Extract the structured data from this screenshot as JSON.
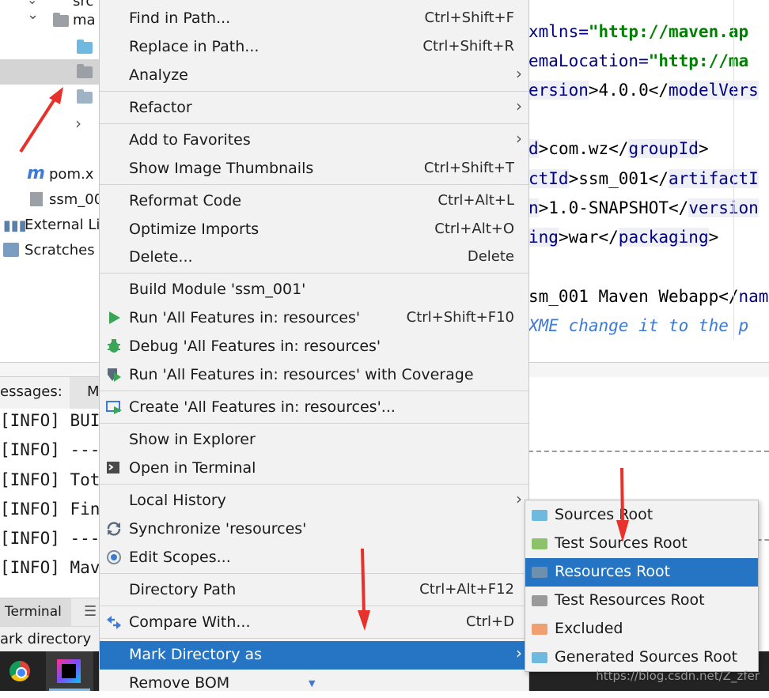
{
  "project_tree": {
    "items": [
      {
        "label": "src"
      },
      {
        "label": "ma"
      },
      {
        "label": "pom.x"
      },
      {
        "label": "ssm_00"
      },
      {
        "label": "External Li"
      },
      {
        "label": "Scratches"
      }
    ]
  },
  "editor": {
    "lines": [
      {
        "a": "xmlns=",
        "b": "\"http://maven.ap"
      },
      {
        "a": "emaLocation=",
        "b": "\"http://ma"
      },
      {
        "a": "ersion",
        "b": ">4.0.0</",
        "c": "modelVers"
      },
      {
        "a": "d",
        "b": ">com.wz</",
        "c": "groupId",
        "d": ">"
      },
      {
        "a": "ctId",
        "b": ">ssm_001</",
        "c": "artifactI"
      },
      {
        "a": "n",
        "b": ">1.0-SNAPSHOT</",
        "c": "version"
      },
      {
        "a": "ing",
        "b": ">war</",
        "c": "packaging",
        "d": ">"
      },
      {
        "a": "sm_001 Maven Webapp</",
        "b": "nam"
      },
      {
        "a": "XME change it to the p"
      }
    ]
  },
  "build_panel": {
    "tab_label": "essages:",
    "tab2_label": "M",
    "lines": [
      "[INFO] BUI",
      "[INFO] ---",
      "[INFO] Tot",
      "[INFO] Fin",
      "[INFO] ---",
      "[INFO] Mav"
    ],
    "terminal_label": "Terminal",
    "status_text": "ark directory"
  },
  "context_menu": {
    "items": [
      {
        "label": "Find in Path...",
        "shortcut": "Ctrl+Shift+F"
      },
      {
        "label": "Replace in Path...",
        "shortcut": "Ctrl+Shift+R"
      },
      {
        "label": "Analyze",
        "submenu": true
      },
      {
        "label": "Refactor",
        "submenu": true
      },
      {
        "label": "Add to Favorites",
        "submenu": true
      },
      {
        "label": "Show Image Thumbnails",
        "shortcut": "Ctrl+Shift+T"
      },
      {
        "label": "Reformat Code",
        "shortcut": "Ctrl+Alt+L"
      },
      {
        "label": "Optimize Imports",
        "shortcut": "Ctrl+Alt+O"
      },
      {
        "label": "Delete...",
        "shortcut": "Delete"
      },
      {
        "label": "Build Module 'ssm_001'"
      },
      {
        "label": "Run 'All Features in: resources'",
        "shortcut": "Ctrl+Shift+F10",
        "icon": "run-icon"
      },
      {
        "label": "Debug 'All Features in: resources'",
        "icon": "debug-icon"
      },
      {
        "label": "Run 'All Features in: resources' with Coverage",
        "icon": "coverage-icon"
      },
      {
        "label": "Create 'All Features in: resources'...",
        "icon": "create-config-icon"
      },
      {
        "label": "Show in Explorer"
      },
      {
        "label": "Open in Terminal",
        "icon": "terminal-icon"
      },
      {
        "label": "Local History",
        "submenu": true
      },
      {
        "label": "Synchronize 'resources'",
        "icon": "sync-icon"
      },
      {
        "label": "Edit Scopes...",
        "icon": "scope-icon"
      },
      {
        "label": "Directory Path",
        "shortcut": "Ctrl+Alt+F12"
      },
      {
        "label": "Compare With...",
        "shortcut": "Ctrl+D",
        "icon": "compare-icon"
      },
      {
        "label": "Mark Directory as",
        "submenu": true,
        "highlighted": true
      },
      {
        "label": "Remove BOM"
      }
    ]
  },
  "submenu": {
    "items": [
      {
        "label": "Sources Root",
        "color": "#6fb8e0"
      },
      {
        "label": "Test Sources Root",
        "color": "#8cc26a"
      },
      {
        "label": "Resources Root",
        "color": "#6f8fae",
        "highlighted": true
      },
      {
        "label": "Test Resources Root",
        "color": "#9a9a9a"
      },
      {
        "label": "Excluded",
        "color": "#f0a070"
      },
      {
        "label": "Generated Sources Root",
        "color": "#6fb8e0"
      }
    ]
  },
  "watermark": "https://blog.csdn.net/Z_zfer",
  "colors": {
    "highlight": "#2675c4",
    "arrow": "#e8312a"
  }
}
